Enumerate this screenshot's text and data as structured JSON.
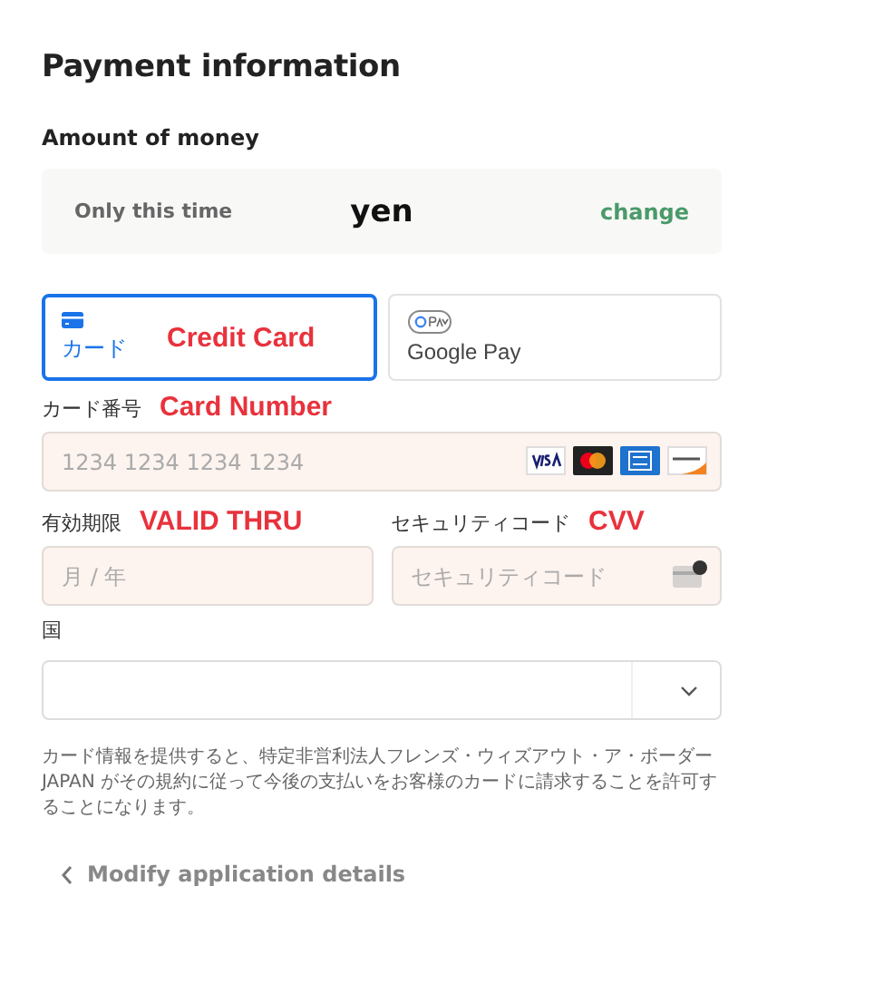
{
  "title": "Payment information",
  "amount": {
    "label": "Amount of money",
    "frequency": "Only this time",
    "value": "yen",
    "change_link": "change"
  },
  "methods": [
    {
      "kind": "card",
      "label": "カード",
      "annotation": "Credit Card",
      "selected": true
    },
    {
      "kind": "gpay",
      "label": "Google Pay",
      "selected": false
    }
  ],
  "card_number": {
    "label": "カード番号",
    "annotation": "Card Number",
    "placeholder": "1234 1234 1234 1234",
    "brands": [
      {
        "kind": "visa"
      },
      {
        "kind": "mastercard"
      },
      {
        "kind": "amex"
      },
      {
        "kind": "discover"
      }
    ]
  },
  "expiry": {
    "label": "有効期限",
    "annotation": "VALID THRU",
    "placeholder": "月 / 年"
  },
  "cvc": {
    "label": "セキュリティコード",
    "annotation": "CVV",
    "placeholder": "セキュリティコード"
  },
  "country": {
    "label": "国"
  },
  "legal_text": "カード情報を提供すると、特定非営利法人フレンズ・ウィズアウト・ア・ボーダーJAPAN がその規約に従って今後の支払いをお客様のカードに請求することを許可することになります。",
  "back_link": "Modify application details"
}
